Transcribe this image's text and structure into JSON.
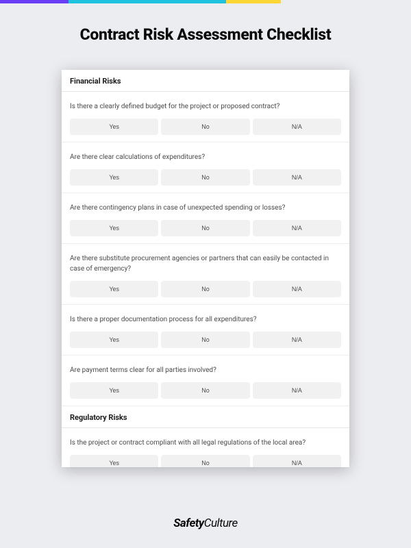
{
  "title": "Contract Risk Assessment Checklist",
  "brand": {
    "bold": "Safety",
    "light": "Culture"
  },
  "options": {
    "yes": "Yes",
    "no": "No",
    "na": "N/A"
  },
  "sections": [
    {
      "title": "Financial Risks",
      "questions": [
        "Is there a clearly defined budget for the project or proposed contract?",
        "Are there clear calculations of expenditures?",
        "Are there contingency plans in case of unexpected spending or losses?",
        "Are there substitute procurement agencies or partners that can easily be contacted in case of emergency?",
        "Is there a proper documentation process for all expenditures?",
        "Are payment terms clear for all parties involved?"
      ]
    },
    {
      "title": "Regulatory Risks",
      "questions": [
        "Is the project or contract compliant with all legal regulations of the local area?"
      ]
    }
  ]
}
